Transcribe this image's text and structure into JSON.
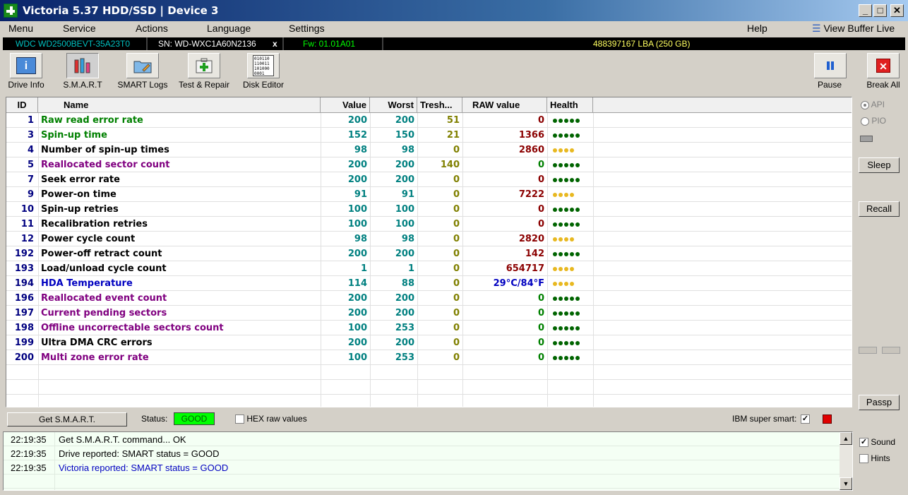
{
  "window": {
    "title": "Victoria 5.37 HDD/SSD | Device 3",
    "minimize": "_",
    "maximize": "□",
    "close": "✕"
  },
  "menu": {
    "items": [
      "Menu",
      "Service",
      "Actions",
      "Language",
      "Settings"
    ],
    "help": "Help",
    "view_buffer": "View Buffer Live"
  },
  "drive": {
    "model": "WDC WD2500BEVT-35A23T0",
    "serial": "SN: WD-WXC1A60N2136",
    "x": "x",
    "firmware": "Fw: 01.01A01",
    "capacity": "488397167 LBA (250 GB)"
  },
  "toolbar": {
    "drive_info": "Drive Info",
    "smart": "S.M.A.R.T",
    "smart_logs": "SMART Logs",
    "test_repair": "Test & Repair",
    "disk_editor": "Disk Editor",
    "pause": "Pause",
    "break_all": "Break All",
    "disk_editor_icon_text": "010110\n110011\n101000\n0001"
  },
  "table": {
    "headers": [
      "ID",
      "Name",
      "Value",
      "Worst",
      "Tresh...",
      "RAW value",
      "Health"
    ],
    "rows": [
      {
        "id": "1",
        "name": "Raw read error rate",
        "value": "200",
        "worst": "200",
        "tresh": "51",
        "raw": "0",
        "health": 5,
        "name_color": "#008000",
        "raw_color": "#8b0000",
        "health_color": "#006400"
      },
      {
        "id": "3",
        "name": "Spin-up time",
        "value": "152",
        "worst": "150",
        "tresh": "21",
        "raw": "1366",
        "health": 5,
        "name_color": "#008000",
        "raw_color": "#8b0000",
        "health_color": "#006400"
      },
      {
        "id": "4",
        "name": "Number of spin-up times",
        "value": "98",
        "worst": "98",
        "tresh": "0",
        "raw": "2860",
        "health": 4,
        "name_color": "#000000",
        "raw_color": "#8b0000",
        "health_color": "#e8b820"
      },
      {
        "id": "5",
        "name": "Reallocated sector count",
        "value": "200",
        "worst": "200",
        "tresh": "140",
        "raw": "0",
        "health": 5,
        "name_color": "#800080",
        "raw_color": "#008000",
        "health_color": "#006400"
      },
      {
        "id": "7",
        "name": "Seek error rate",
        "value": "200",
        "worst": "200",
        "tresh": "0",
        "raw": "0",
        "health": 5,
        "name_color": "#000000",
        "raw_color": "#8b0000",
        "health_color": "#006400"
      },
      {
        "id": "9",
        "name": "Power-on time",
        "value": "91",
        "worst": "91",
        "tresh": "0",
        "raw": "7222",
        "health": 4,
        "name_color": "#000000",
        "raw_color": "#8b0000",
        "health_color": "#e8b820"
      },
      {
        "id": "10",
        "name": "Spin-up retries",
        "value": "100",
        "worst": "100",
        "tresh": "0",
        "raw": "0",
        "health": 5,
        "name_color": "#000000",
        "raw_color": "#8b0000",
        "health_color": "#006400"
      },
      {
        "id": "11",
        "name": "Recalibration retries",
        "value": "100",
        "worst": "100",
        "tresh": "0",
        "raw": "0",
        "health": 5,
        "name_color": "#000000",
        "raw_color": "#8b0000",
        "health_color": "#006400"
      },
      {
        "id": "12",
        "name": "Power cycle count",
        "value": "98",
        "worst": "98",
        "tresh": "0",
        "raw": "2820",
        "health": 4,
        "name_color": "#000000",
        "raw_color": "#8b0000",
        "health_color": "#e8b820"
      },
      {
        "id": "192",
        "name": "Power-off retract count",
        "value": "200",
        "worst": "200",
        "tresh": "0",
        "raw": "142",
        "health": 5,
        "name_color": "#000000",
        "raw_color": "#8b0000",
        "health_color": "#006400"
      },
      {
        "id": "193",
        "name": "Load/unload cycle count",
        "value": "1",
        "worst": "1",
        "tresh": "0",
        "raw": "654717",
        "health": 4,
        "name_color": "#000000",
        "raw_color": "#8b0000",
        "health_color": "#e8b820"
      },
      {
        "id": "194",
        "name": "HDA Temperature",
        "value": "114",
        "worst": "88",
        "tresh": "0",
        "raw": "29°C/84°F",
        "health": 4,
        "name_color": "#0000c0",
        "raw_color": "#0000c0",
        "health_color": "#e8b820"
      },
      {
        "id": "196",
        "name": "Reallocated event count",
        "value": "200",
        "worst": "200",
        "tresh": "0",
        "raw": "0",
        "health": 5,
        "name_color": "#800080",
        "raw_color": "#008000",
        "health_color": "#006400"
      },
      {
        "id": "197",
        "name": "Current pending sectors",
        "value": "200",
        "worst": "200",
        "tresh": "0",
        "raw": "0",
        "health": 5,
        "name_color": "#800080",
        "raw_color": "#008000",
        "health_color": "#006400"
      },
      {
        "id": "198",
        "name": "Offline uncorrectable sectors count",
        "value": "100",
        "worst": "253",
        "tresh": "0",
        "raw": "0",
        "health": 5,
        "name_color": "#800080",
        "raw_color": "#008000",
        "health_color": "#006400"
      },
      {
        "id": "199",
        "name": "Ultra DMA CRC errors",
        "value": "200",
        "worst": "200",
        "tresh": "0",
        "raw": "0",
        "health": 5,
        "name_color": "#000000",
        "raw_color": "#008000",
        "health_color": "#006400"
      },
      {
        "id": "200",
        "name": "Multi zone error rate",
        "value": "100",
        "worst": "253",
        "tresh": "0",
        "raw": "0",
        "health": 5,
        "name_color": "#800080",
        "raw_color": "#008000",
        "health_color": "#006400"
      }
    ]
  },
  "status": {
    "get_smart": "Get S.M.A.R.T.",
    "status_label": "Status:",
    "status_value": "GOOD",
    "hex_label": "HEX raw values",
    "ibm_label": "IBM super smart:",
    "ibm_checked": "✓"
  },
  "log": [
    {
      "time": "22:19:35",
      "text": "Get S.M.A.R.T. command... OK",
      "color": "#000000"
    },
    {
      "time": "22:19:35",
      "text": "Drive reported: SMART status = GOOD",
      "color": "#000000"
    },
    {
      "time": "22:19:35",
      "text": "Victoria reported: SMART status = GOOD",
      "color": "#0000c0"
    }
  ],
  "side": {
    "api": "API",
    "pio": "PIO",
    "sleep": "Sleep",
    "recall": "Recall",
    "passp": "Passp",
    "sound": "Sound",
    "hints": "Hints",
    "sound_checked": "✓"
  },
  "colors": {
    "value": "#008080",
    "tresh": "#808000",
    "id": "#000080",
    "good_bg": "#00ff00"
  }
}
